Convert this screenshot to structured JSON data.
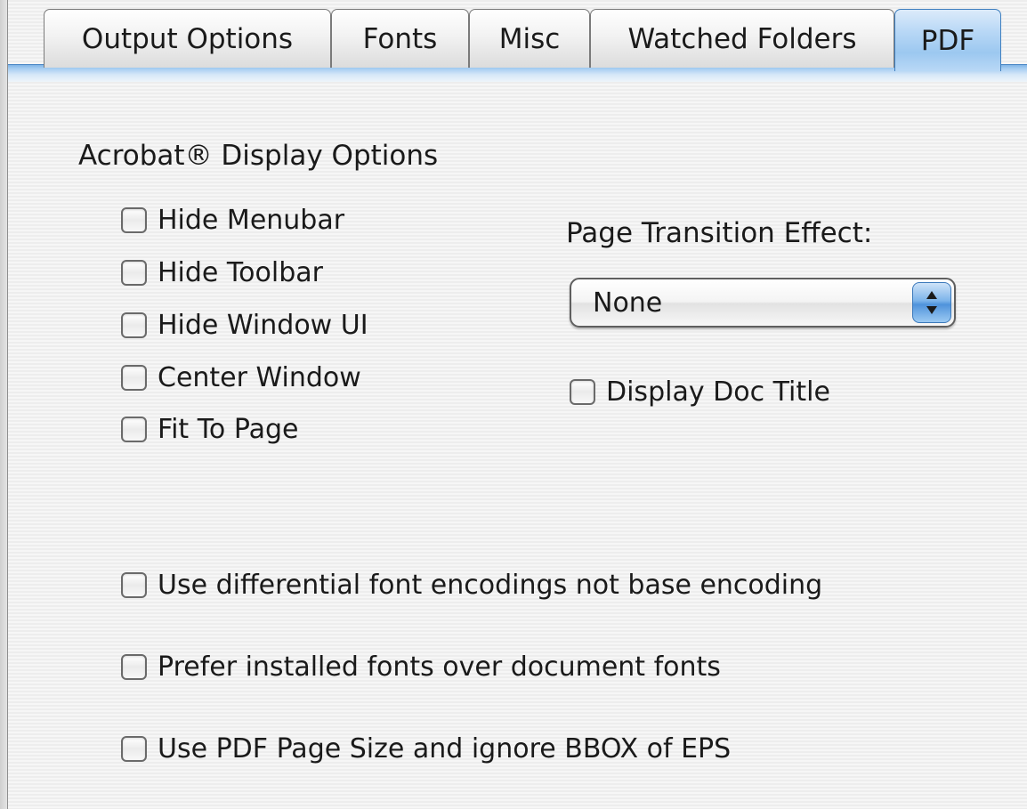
{
  "tabs": [
    {
      "label": "Output Options",
      "selected": false
    },
    {
      "label": "Fonts",
      "selected": false
    },
    {
      "label": "Misc",
      "selected": false
    },
    {
      "label": "Watched Folders",
      "selected": false
    },
    {
      "label": "PDF",
      "selected": true
    }
  ],
  "acrobat_display_options": {
    "title": "Acrobat® Display Options",
    "checkboxes": [
      {
        "label": "Hide Menubar",
        "checked": false
      },
      {
        "label": "Hide Toolbar",
        "checked": false
      },
      {
        "label": "Hide Window UI",
        "checked": false
      },
      {
        "label": "Center Window",
        "checked": false
      },
      {
        "label": "Fit To Page",
        "checked": false
      }
    ]
  },
  "page_transition": {
    "label": "Page Transition Effect:",
    "selected_value": "None"
  },
  "display_doc_title": {
    "label": "Display Doc Title",
    "checked": false
  },
  "font_options": [
    {
      "label": "Use differential font encodings not base encoding",
      "checked": false
    },
    {
      "label": "Prefer installed fonts over document fonts",
      "checked": false
    },
    {
      "label": "Use PDF Page Size and ignore BBOX of EPS",
      "checked": false
    }
  ],
  "colors": {
    "selected_tab": "#9cc8f0",
    "tab_divider": "#7fb4e6",
    "popup_arrows": "#4f93db"
  },
  "icons": {
    "popup_arrows": "up-down-arrows-icon"
  }
}
